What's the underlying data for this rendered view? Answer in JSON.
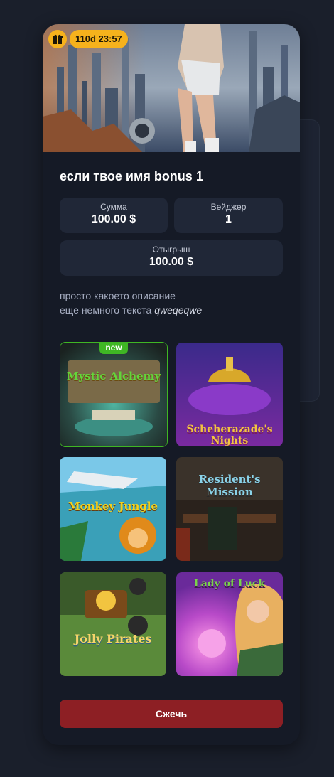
{
  "bonus": {
    "timer": "110d 23:57",
    "title": "если твое имя bonus 1",
    "stats": {
      "amount_label": "Сумма",
      "amount_value": "100.00 $",
      "wager_label": "Вейджер",
      "wager_value": "1",
      "winback_label": "Отыгрыш",
      "winback_value": "100.00 $"
    },
    "description_line1": "просто какоето описание",
    "description_line2_plain": "еще немного текста",
    "description_line2_italic": "qweqeqwe"
  },
  "games": [
    {
      "title": "Mystic Alchemy",
      "badge": "new"
    },
    {
      "title": "Scheherazade's Nights"
    },
    {
      "title": "Monkey Jungle"
    },
    {
      "title": "Resident's Mission"
    },
    {
      "title": "Jolly Pirates"
    },
    {
      "title": "Lady of Luck"
    }
  ],
  "burn_button": "Сжечь",
  "colors": {
    "accent": "#f6b21c",
    "card_bg": "#151a26",
    "stat_bg": "#202737",
    "burn_button": "#8d1f24",
    "new_badge": "#3fb624"
  },
  "icons": {
    "gift": "gift-icon"
  }
}
